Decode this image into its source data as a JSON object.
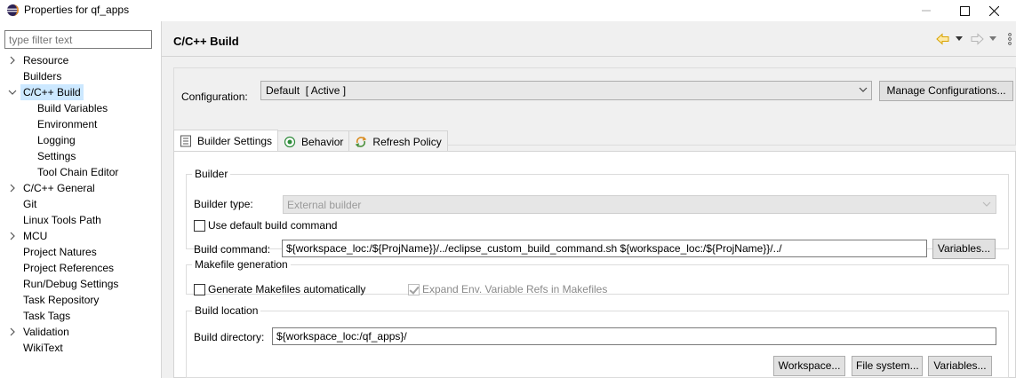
{
  "window": {
    "title": "Properties for qf_apps",
    "app_icon": "eclipse-icon",
    "controls": [
      "minimize",
      "maximize",
      "close"
    ]
  },
  "filter": {
    "placeholder": "type filter text"
  },
  "tree": [
    {
      "label": "Resource",
      "level": 0,
      "expandable": true,
      "expanded": false
    },
    {
      "label": "Builders",
      "level": 0,
      "expandable": false
    },
    {
      "label": "C/C++ Build",
      "level": 0,
      "expandable": true,
      "expanded": true,
      "selected": true
    },
    {
      "label": "Build Variables",
      "level": 1,
      "expandable": false
    },
    {
      "label": "Environment",
      "level": 1,
      "expandable": false
    },
    {
      "label": "Logging",
      "level": 1,
      "expandable": false
    },
    {
      "label": "Settings",
      "level": 1,
      "expandable": false
    },
    {
      "label": "Tool Chain Editor",
      "level": 1,
      "expandable": false
    },
    {
      "label": "C/C++ General",
      "level": 0,
      "expandable": true,
      "expanded": false
    },
    {
      "label": "Git",
      "level": 0,
      "expandable": false
    },
    {
      "label": "Linux Tools Path",
      "level": 0,
      "expandable": false
    },
    {
      "label": "MCU",
      "level": 0,
      "expandable": true,
      "expanded": false
    },
    {
      "label": "Project Natures",
      "level": 0,
      "expandable": false
    },
    {
      "label": "Project References",
      "level": 0,
      "expandable": false
    },
    {
      "label": "Run/Debug Settings",
      "level": 0,
      "expandable": false
    },
    {
      "label": "Task Repository",
      "level": 0,
      "expandable": false
    },
    {
      "label": "Task Tags",
      "level": 0,
      "expandable": false
    },
    {
      "label": "Validation",
      "level": 0,
      "expandable": true,
      "expanded": false
    },
    {
      "label": "WikiText",
      "level": 0,
      "expandable": false
    }
  ],
  "page": {
    "title": "C/C++ Build"
  },
  "configuration": {
    "label": "Configuration:",
    "value": "Default  [ Active ]",
    "manage_button": "Manage Configurations..."
  },
  "tabs": [
    {
      "label": "Builder Settings",
      "icon": "builder-settings-icon",
      "active": true
    },
    {
      "label": "Behavior",
      "icon": "behavior-icon",
      "active": false
    },
    {
      "label": "Refresh Policy",
      "icon": "refresh-policy-icon",
      "active": false
    }
  ],
  "builder": {
    "legend": "Builder",
    "type_label": "Builder type:",
    "type_value": "External builder",
    "use_default_label": "Use default build command",
    "use_default_checked": false,
    "command_label": "Build command:",
    "command_value": "${workspace_loc:/${ProjName}}/../eclipse_custom_build_command.sh ${workspace_loc:/${ProjName}}/../",
    "variables_button": "Variables..."
  },
  "makefile": {
    "legend": "Makefile generation",
    "generate_label": "Generate Makefiles automatically",
    "generate_checked": false,
    "expand_label": "Expand Env. Variable Refs in Makefiles",
    "expand_checked": true
  },
  "location": {
    "legend": "Build location",
    "dir_label": "Build directory:",
    "dir_value": "${workspace_loc:/qf_apps}/",
    "workspace_button": "Workspace...",
    "filesystem_button": "File system...",
    "variables_button": "Variables..."
  },
  "colors": {
    "selection": "#cce8ff",
    "panel_bg": "#f0f0f0",
    "nav_back_arrow": "#e0a800"
  }
}
